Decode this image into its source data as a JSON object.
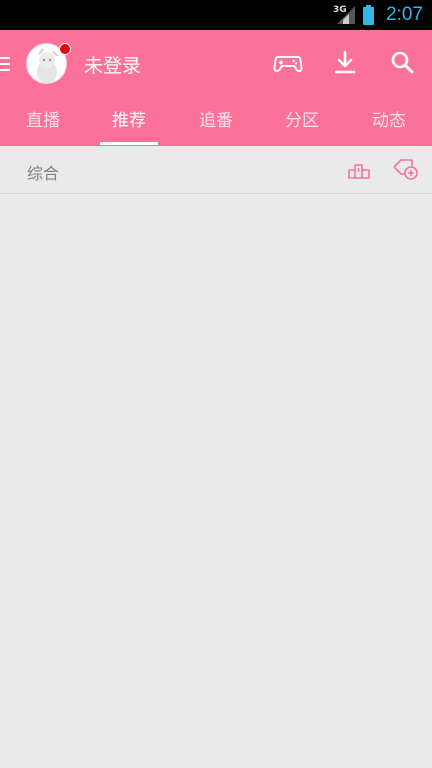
{
  "status_bar": {
    "network": "3G",
    "time": "2:07"
  },
  "header": {
    "user_label": "未登录",
    "icons": [
      "menu-icon",
      "avatar",
      "game-controller-icon",
      "download-icon",
      "search-icon"
    ]
  },
  "tabs": [
    {
      "label": "直播",
      "active": false
    },
    {
      "label": "推荐",
      "active": true
    },
    {
      "label": "追番",
      "active": false
    },
    {
      "label": "分区",
      "active": false
    },
    {
      "label": "动态",
      "active": false
    }
  ],
  "sub_bar": {
    "title": "综合",
    "icons": [
      "ranking-icon",
      "tag-add-icon"
    ]
  },
  "colors": {
    "brand_pink": "#fb7299",
    "notification_red": "#e60012",
    "status_clock": "#33b5e5",
    "background": "#eaeaea"
  }
}
